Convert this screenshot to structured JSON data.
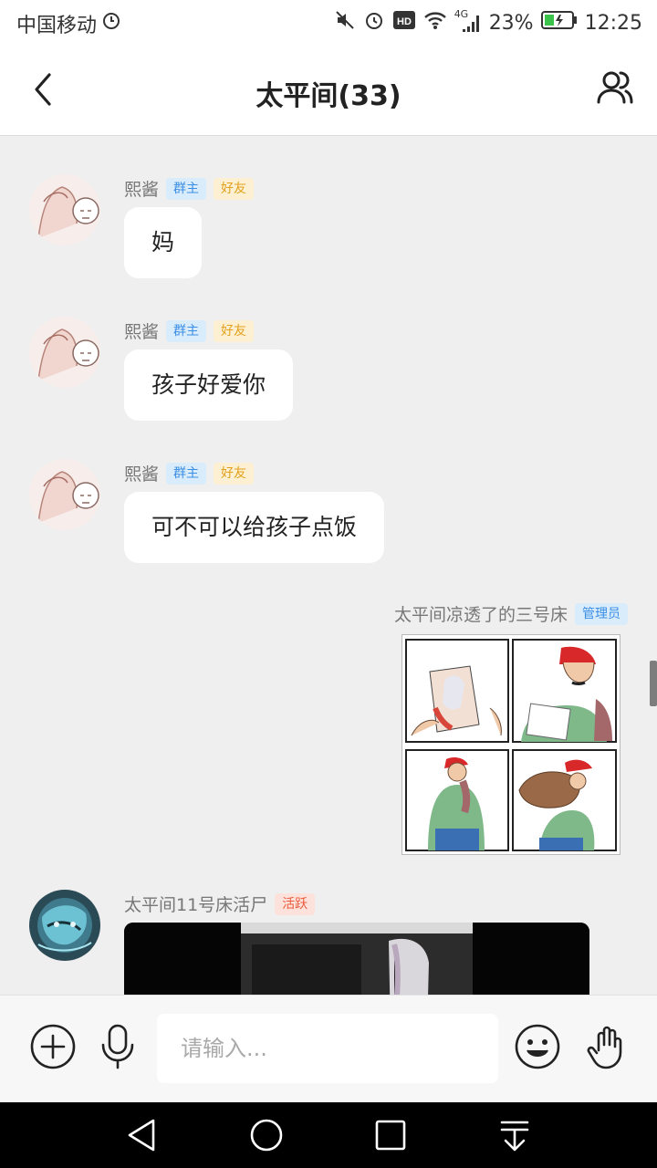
{
  "status_bar": {
    "carrier": "中国移动",
    "network": "4G",
    "battery": "23%",
    "time": "12:25"
  },
  "header": {
    "title": "太平间(33)"
  },
  "messages": [
    {
      "sender": "熙酱",
      "badges": [
        "群主",
        "好友"
      ],
      "text": "妈"
    },
    {
      "sender": "熙酱",
      "badges": [
        "群主",
        "好友"
      ],
      "text": "孩子好爱你"
    },
    {
      "sender": "熙酱",
      "badges": [
        "群主",
        "好友"
      ],
      "text": "可不可以给孩子点饭"
    },
    {
      "sender": "太平间凉透了的三号床",
      "badges": [
        "管理员"
      ],
      "image": "comic-image"
    },
    {
      "sender": "太平间11号床活尸",
      "badges": [
        "活跃"
      ],
      "video": "video-thumbnail"
    }
  ],
  "input_bar": {
    "placeholder": "请输入..."
  },
  "icons": {
    "back": "chevron-left-icon",
    "members": "group-members-icon",
    "add": "plus-circle-icon",
    "voice": "microphone-icon",
    "emoji": "smiley-icon",
    "poke": "hand-gesture-icon"
  },
  "colors": {
    "badge_blue": "#3a8ee6",
    "badge_orange": "#e2a11c",
    "badge_red": "#ea5a3a",
    "background": "#efefef"
  }
}
